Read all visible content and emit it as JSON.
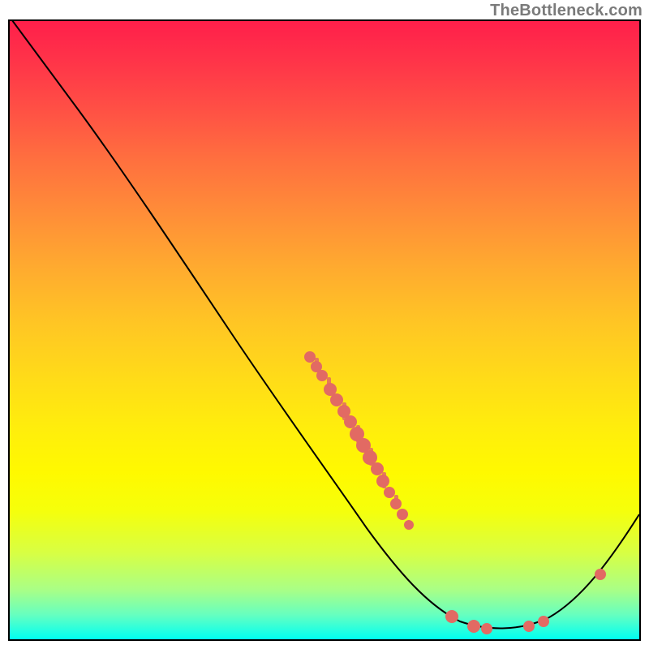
{
  "watermark": "TheBottleneck.com",
  "chart_data": {
    "type": "line",
    "title": "",
    "xlabel": "",
    "ylabel": "",
    "xlim": [
      0,
      100
    ],
    "ylim": [
      0,
      100
    ],
    "grid": false,
    "legend": false,
    "background": "vertical-gradient red→orange→yellow→green top-to-bottom (heat map of bottleneck severity)",
    "series": [
      {
        "name": "curve",
        "x": [
          0,
          5,
          12,
          20,
          30,
          40,
          50,
          58,
          65,
          72,
          78,
          83,
          88,
          94,
          100
        ],
        "y": [
          100,
          95,
          88,
          78,
          65,
          51,
          38,
          27,
          18,
          10,
          4,
          1,
          3,
          11,
          20
        ]
      }
    ],
    "markers_on_curve": [
      {
        "name": "cluster-descending",
        "x_range": [
          48,
          64
        ],
        "count_approx": 15
      },
      {
        "name": "cluster-trough",
        "x_range": [
          70,
          85
        ],
        "count_approx": 5
      },
      {
        "name": "cluster-rising",
        "x_range": [
          93,
          94
        ],
        "count_approx": 1
      }
    ],
    "notes": "Axes carry no tick labels or titles in the source image; values above are proportional estimates (0–100) read from the curve geometry. The colored background is a continuous vertical gradient, not a data layer."
  }
}
